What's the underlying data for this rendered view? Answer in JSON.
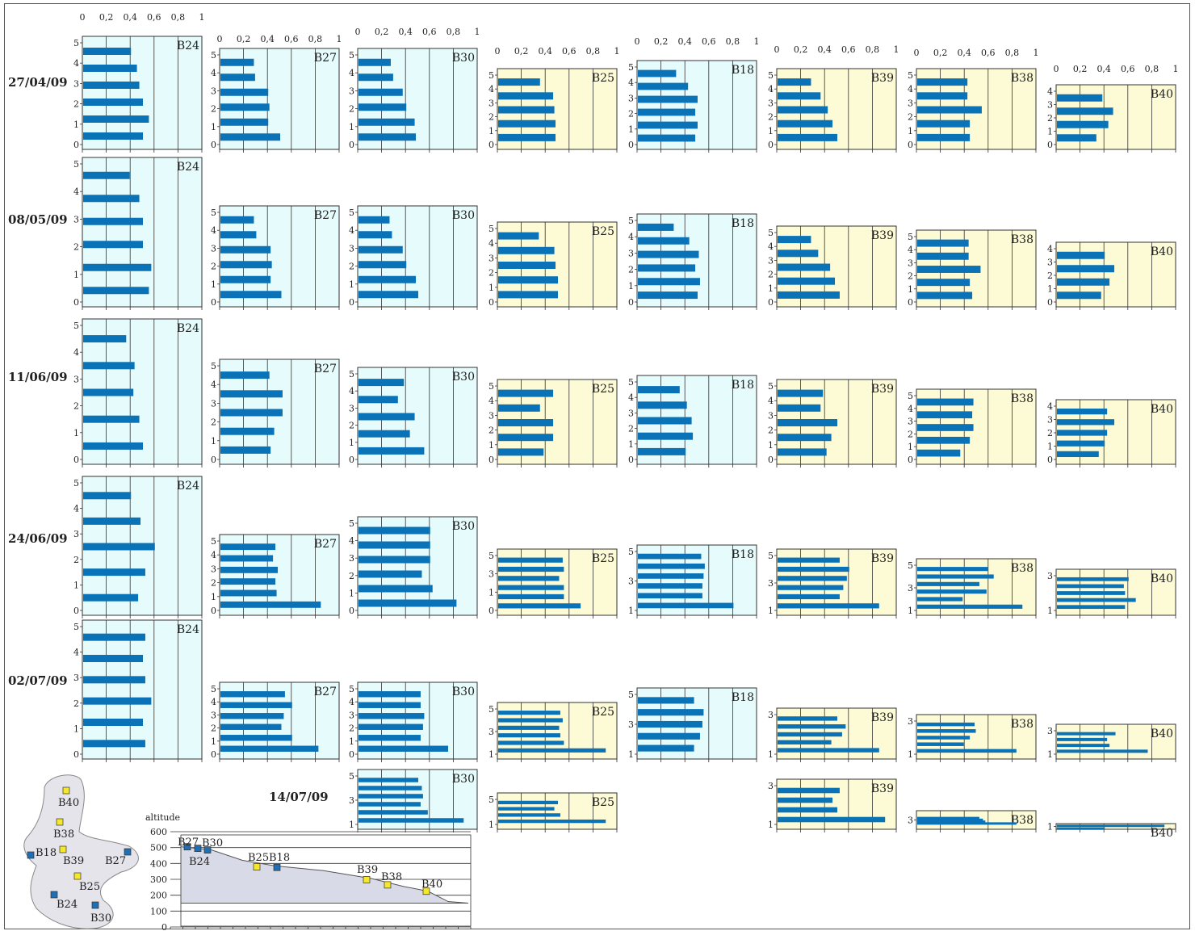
{
  "colors": {
    "bar": "#0a73b8",
    "panel_blue": "#e6fbfc",
    "panel_yellow": "#fdfbd6",
    "pt_blue": "#1e6fb5",
    "pt_yellow": "#f5e72a",
    "grid": "#333333",
    "profile_fill": "#d8dae7"
  },
  "dates": [
    "27/04/09",
    "08/05/09",
    "11/06/09",
    "24/06/09",
    "02/07/09",
    "14/07/09"
  ],
  "x_ticks": [
    "0",
    "0,2",
    "0,4",
    "0,6",
    "0,8",
    "1"
  ],
  "panel_bg": {
    "B24": "blue",
    "B27": "blue",
    "B30": "blue",
    "B25": "yellow",
    "B18": "blue",
    "B39": "yellow",
    "B38": "yellow",
    "B40": "yellow"
  },
  "chart_data": {
    "type": "bar",
    "orientation": "horizontal",
    "xlim": [
      0,
      1
    ],
    "x_ticks": [
      0,
      0.2,
      0.4,
      0.6,
      0.8,
      1
    ],
    "grid": true,
    "rows": [
      {
        "date": "27/04/09",
        "panels": [
          {
            "station": "B24",
            "y_ticks": [
              "0",
              "1",
              "2",
              "3",
              "4",
              "5"
            ],
            "values": [
              0.5,
              0.55,
              0.5,
              0.47,
              0.45,
              0.4
            ]
          },
          {
            "station": "B27",
            "y_ticks": [
              "0",
              "1",
              "2",
              "3",
              "4",
              "5"
            ],
            "values": [
              0.5,
              0.4,
              0.41,
              0.4,
              0.29,
              0.28
            ]
          },
          {
            "station": "B30",
            "y_ticks": [
              "0",
              "1",
              "2",
              "3",
              "4",
              "5"
            ],
            "values": [
              0.48,
              0.47,
              0.4,
              0.37,
              0.29,
              0.27
            ]
          },
          {
            "station": "B25",
            "y_ticks": [
              "0",
              "1",
              "2",
              "3",
              "4",
              "5"
            ],
            "values": [
              0.48,
              0.48,
              0.47,
              0.46,
              0.35
            ]
          },
          {
            "station": "B18",
            "y_ticks": [
              "0",
              "1",
              "2",
              "3",
              "4",
              "5"
            ],
            "values": [
              0.48,
              0.5,
              0.48,
              0.5,
              0.42,
              0.32
            ]
          },
          {
            "station": "B39",
            "y_ticks": [
              "0",
              "1",
              "2",
              "3",
              "4",
              "5"
            ],
            "values": [
              0.5,
              0.46,
              0.42,
              0.36,
              0.28
            ]
          },
          {
            "station": "B38",
            "y_ticks": [
              "0",
              "1",
              "2",
              "3",
              "4",
              "5"
            ],
            "values": [
              0.44,
              0.44,
              0.54,
              0.42,
              0.42
            ]
          },
          {
            "station": "B40",
            "y_ticks": [
              "0",
              "1",
              "2",
              "3",
              "4"
            ],
            "values": [
              0.33,
              0.43,
              0.47,
              0.38
            ]
          }
        ]
      },
      {
        "date": "08/05/09",
        "panels": [
          {
            "station": "B24",
            "y_ticks": [
              "0",
              "1",
              "2",
              "3",
              "4",
              "5"
            ],
            "values": [
              0.55,
              0.57,
              0.5,
              0.5,
              0.47,
              0.39
            ]
          },
          {
            "station": "B27",
            "y_ticks": [
              "0",
              "1",
              "2",
              "3",
              "4",
              "5"
            ],
            "values": [
              0.51,
              0.42,
              0.43,
              0.42,
              0.3,
              0.28
            ]
          },
          {
            "station": "B30",
            "y_ticks": [
              "0",
              "1",
              "2",
              "3",
              "4",
              "5"
            ],
            "values": [
              0.5,
              0.48,
              0.4,
              0.37,
              0.28,
              0.26
            ]
          },
          {
            "station": "B25",
            "y_ticks": [
              "0",
              "1",
              "2",
              "3",
              "4",
              "5"
            ],
            "values": [
              0.5,
              0.5,
              0.48,
              0.47,
              0.34
            ]
          },
          {
            "station": "B18",
            "y_ticks": [
              "0",
              "1",
              "2",
              "3",
              "4",
              "5"
            ],
            "values": [
              0.5,
              0.52,
              0.48,
              0.51,
              0.43,
              0.3
            ]
          },
          {
            "station": "B39",
            "y_ticks": [
              "0",
              "1",
              "2",
              "3",
              "4",
              "5"
            ],
            "values": [
              0.52,
              0.48,
              0.44,
              0.34,
              0.28
            ]
          },
          {
            "station": "B38",
            "y_ticks": [
              "0",
              "1",
              "2",
              "3",
              "4",
              "5"
            ],
            "values": [
              0.46,
              0.44,
              0.53,
              0.43,
              0.43
            ]
          },
          {
            "station": "B40",
            "y_ticks": [
              "0",
              "1",
              "2",
              "3",
              "4"
            ],
            "values": [
              0.37,
              0.44,
              0.48,
              0.4
            ]
          }
        ]
      },
      {
        "date": "11/06/09",
        "panels": [
          {
            "station": "B24",
            "y_ticks": [
              "0",
              "1",
              "2",
              "3",
              "4",
              "5"
            ],
            "values": [
              0.5,
              0.47,
              0.42,
              0.43,
              0.36
            ]
          },
          {
            "station": "B27",
            "y_ticks": [
              "0",
              "1",
              "2",
              "3",
              "4",
              "5"
            ],
            "values": [
              0.42,
              0.45,
              0.52,
              0.52,
              0.41
            ]
          },
          {
            "station": "B30",
            "y_ticks": [
              "0",
              "1",
              "2",
              "3",
              "4",
              "5"
            ],
            "values": [
              0.55,
              0.43,
              0.47,
              0.33,
              0.38
            ]
          },
          {
            "station": "B25",
            "y_ticks": [
              "0",
              "1",
              "2",
              "3",
              "4",
              "5"
            ],
            "values": [
              0.38,
              0.46,
              0.46,
              0.35,
              0.46
            ]
          },
          {
            "station": "B18",
            "y_ticks": [
              "0",
              "1",
              "2",
              "3",
              "4",
              "5"
            ],
            "values": [
              0.4,
              0.46,
              0.45,
              0.41,
              0.35
            ]
          },
          {
            "station": "B39",
            "y_ticks": [
              "0",
              "1",
              "2",
              "3",
              "4",
              "5"
            ],
            "values": [
              0.41,
              0.45,
              0.5,
              0.36,
              0.38
            ]
          },
          {
            "station": "B38",
            "y_ticks": [
              "0",
              "1",
              "2",
              "3",
              "4",
              "5"
            ],
            "values": [
              0.36,
              0.44,
              0.47,
              0.46,
              0.47
            ]
          },
          {
            "station": "B40",
            "y_ticks": [
              "0",
              "1",
              "2",
              "3",
              "4"
            ],
            "values": [
              0.35,
              0.4,
              0.42,
              0.48,
              0.42
            ]
          }
        ]
      },
      {
        "date": "24/06/09",
        "panels": [
          {
            "station": "B24",
            "y_ticks": [
              "0",
              "1",
              "2",
              "3",
              "4",
              "5"
            ],
            "values": [
              0.46,
              0.52,
              0.6,
              0.48,
              0.4
            ]
          },
          {
            "station": "B27",
            "y_ticks": [
              "0",
              "1",
              "2",
              "3",
              "4",
              "5"
            ],
            "values": [
              0.84,
              0.47,
              0.46,
              0.48,
              0.44,
              0.46
            ]
          },
          {
            "station": "B30",
            "y_ticks": [
              "0",
              "1",
              "2",
              "3",
              "4",
              "5"
            ],
            "values": [
              0.82,
              0.62,
              0.53,
              0.6,
              0.6,
              0.6
            ]
          },
          {
            "station": "B25",
            "y_ticks": [
              "0",
              "1",
              "3",
              "5"
            ],
            "values": [
              0.69,
              0.55,
              0.55,
              0.51,
              0.55,
              0.54
            ]
          },
          {
            "station": "B18",
            "y_ticks": [
              "1",
              "3",
              "5"
            ],
            "values": [
              0.8,
              0.54,
              0.54,
              0.55,
              0.56,
              0.53
            ]
          },
          {
            "station": "B39",
            "y_ticks": [
              "1",
              "3",
              "5"
            ],
            "values": [
              0.85,
              0.52,
              0.55,
              0.58,
              0.6,
              0.52
            ]
          },
          {
            "station": "B38",
            "y_ticks": [
              "1",
              "3",
              "5"
            ],
            "values": [
              0.88,
              0.38,
              0.58,
              0.52,
              0.64,
              0.59
            ]
          },
          {
            "station": "B40",
            "y_ticks": [
              "1",
              "3"
            ],
            "values": [
              0.57,
              0.66,
              0.57,
              0.56,
              0.6
            ]
          }
        ]
      },
      {
        "date": "02/07/09",
        "panels": [
          {
            "station": "B24",
            "y_ticks": [
              "0",
              "1",
              "2",
              "3",
              "4",
              "5"
            ],
            "values": [
              0.52,
              0.5,
              0.57,
              0.52,
              0.5,
              0.52
            ]
          },
          {
            "station": "B27",
            "y_ticks": [
              "0",
              "1",
              "2",
              "3",
              "4",
              "5"
            ],
            "values": [
              0.82,
              0.6,
              0.51,
              0.53,
              0.6,
              0.54
            ]
          },
          {
            "station": "B30",
            "y_ticks": [
              "0",
              "1",
              "2",
              "3",
              "4",
              "5"
            ],
            "values": [
              0.75,
              0.52,
              0.54,
              0.55,
              0.52,
              0.52
            ]
          },
          {
            "station": "B25",
            "y_ticks": [
              "1",
              "3",
              "5"
            ],
            "values": [
              0.9,
              0.55,
              0.52,
              0.51,
              0.54,
              0.52
            ]
          },
          {
            "station": "B18",
            "y_ticks": [
              "1",
              "3",
              "5"
            ],
            "values": [
              0.47,
              0.52,
              0.54,
              0.55,
              0.47
            ]
          },
          {
            "station": "B39",
            "y_ticks": [
              "1",
              "3"
            ],
            "values": [
              0.85,
              0.45,
              0.54,
              0.57,
              0.5
            ]
          },
          {
            "station": "B38",
            "y_ticks": [
              "1",
              "3"
            ],
            "values": [
              0.83,
              0.39,
              0.44,
              0.49,
              0.48
            ]
          },
          {
            "station": "B40",
            "y_ticks": [
              "1",
              "3"
            ],
            "values": [
              0.76,
              0.44,
              0.42,
              0.49
            ]
          }
        ]
      },
      {
        "date": "14/07/09",
        "panels": [
          {
            "station": "B30",
            "y_ticks": [
              "1",
              "3",
              "5"
            ],
            "values": [
              0.88,
              0.58,
              0.52,
              0.54,
              0.53,
              0.5
            ]
          },
          {
            "station": "B25",
            "y_ticks": [
              "1",
              "5"
            ],
            "values": [
              0.9,
              0.52,
              0.47,
              0.5
            ]
          },
          {
            "station": "B39",
            "y_ticks": [
              "1",
              "3"
            ],
            "values": [
              0.9,
              0.5,
              0.46,
              0.52
            ]
          },
          {
            "station": "B38",
            "y_ticks": [
              "3"
            ],
            "values": [
              0.83,
              0.57,
              0.55,
              0.52
            ]
          },
          {
            "station": "B40",
            "y_ticks": [
              "1"
            ],
            "values": [
              0.9,
              0.4
            ]
          }
        ]
      }
    ],
    "profile": {
      "ylabel": "altitude",
      "y_ticks": [
        0,
        100,
        200,
        300,
        400,
        500,
        600
      ],
      "ylim": [
        0,
        600
      ],
      "stations": [
        {
          "name": "B27",
          "altitude": 505,
          "color": "blue"
        },
        {
          "name": "B24",
          "altitude": 495,
          "color": "blue"
        },
        {
          "name": "B30",
          "altitude": 485,
          "color": "blue"
        },
        {
          "name": "B25",
          "altitude": 378,
          "color": "yellow"
        },
        {
          "name": "B18",
          "altitude": 375,
          "color": "blue"
        },
        {
          "name": "B39",
          "altitude": 298,
          "color": "yellow"
        },
        {
          "name": "B38",
          "altitude": 265,
          "color": "yellow"
        },
        {
          "name": "B40",
          "altitude": 225,
          "color": "yellow"
        }
      ]
    },
    "map_stations": [
      {
        "name": "B40",
        "color": "yellow"
      },
      {
        "name": "B38",
        "color": "yellow"
      },
      {
        "name": "B18",
        "color": "blue"
      },
      {
        "name": "B39",
        "color": "yellow"
      },
      {
        "name": "B27",
        "color": "blue"
      },
      {
        "name": "B25",
        "color": "yellow"
      },
      {
        "name": "B24",
        "color": "blue"
      },
      {
        "name": "B30",
        "color": "blue"
      }
    ]
  }
}
